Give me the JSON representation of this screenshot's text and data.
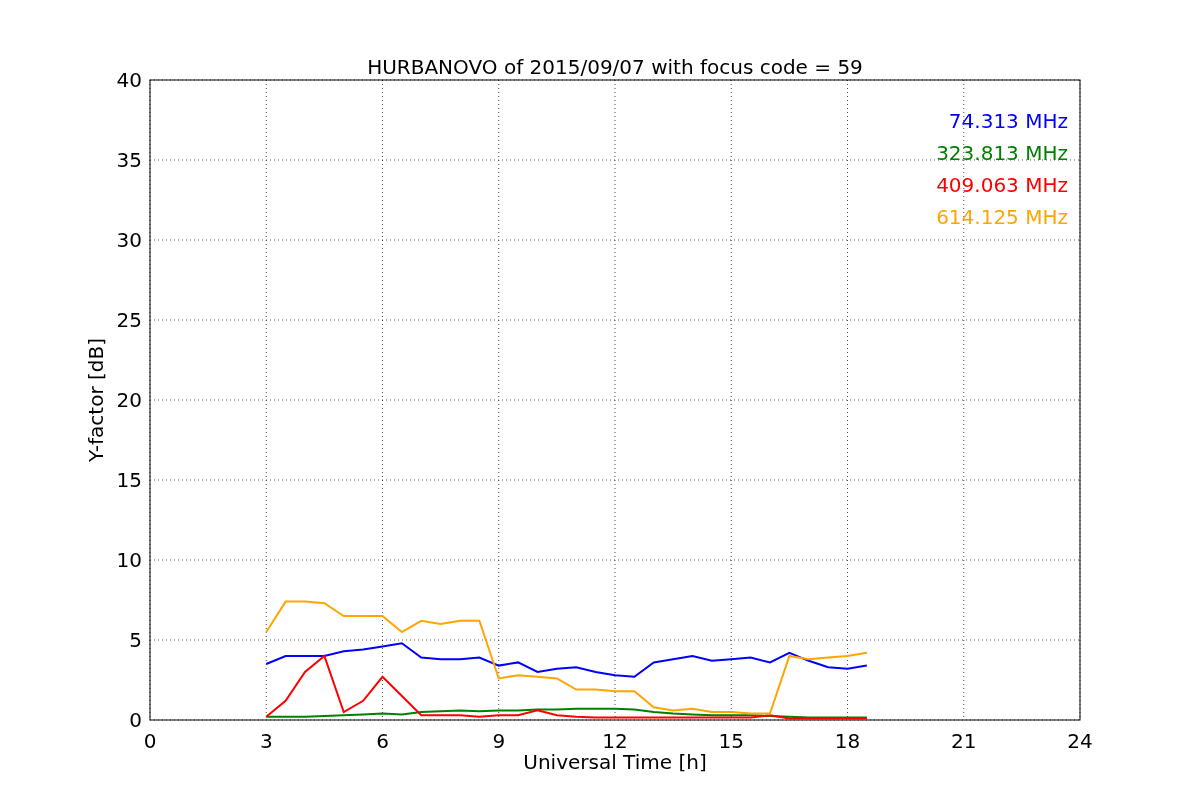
{
  "chart_data": {
    "type": "line",
    "title": "HURBANOVO of 2015/09/07 with focus code = 59",
    "xlabel": "Universal Time [h]",
    "ylabel": "Y-factor [dB]",
    "x": [
      3,
      3.5,
      4,
      4.5,
      5,
      5.5,
      6,
      6.5,
      7,
      7.5,
      8,
      8.5,
      9,
      9.5,
      10,
      10.5,
      11,
      11.5,
      12,
      12.5,
      13,
      13.5,
      14,
      14.5,
      15,
      15.5,
      16,
      16.5,
      17,
      17.5,
      18,
      18.5
    ],
    "series": [
      {
        "name": "74.313 MHz",
        "color": "#0000ff",
        "values": [
          3.5,
          4,
          4,
          4,
          4.3,
          4.4,
          4.6,
          4.8,
          3.9,
          3.8,
          3.8,
          3.9,
          3.4,
          3.6,
          3,
          3.2,
          3.3,
          3,
          2.8,
          2.7,
          3.6,
          3.8,
          4,
          3.7,
          3.8,
          3.9,
          3.6,
          4.2,
          3.7,
          3.3,
          3.2,
          3.4
        ]
      },
      {
        "name": "323.813 MHz",
        "color": "#008000",
        "values": [
          0.2,
          0.2,
          0.2,
          0.25,
          0.3,
          0.35,
          0.4,
          0.35,
          0.5,
          0.55,
          0.6,
          0.55,
          0.6,
          0.6,
          0.65,
          0.65,
          0.7,
          0.7,
          0.7,
          0.65,
          0.5,
          0.4,
          0.35,
          0.3,
          0.3,
          0.3,
          0.25,
          0.2,
          0.15,
          0.15,
          0.15,
          0.15
        ]
      },
      {
        "name": "409.063 MHz",
        "color": "#ff0000",
        "values": [
          0.2,
          1.2,
          3,
          4,
          0.5,
          1.2,
          2.7,
          1.5,
          0.3,
          0.3,
          0.3,
          0.2,
          0.3,
          0.3,
          0.6,
          0.3,
          0.2,
          0.15,
          0.15,
          0.15,
          0.15,
          0.15,
          0.15,
          0.15,
          0.15,
          0.15,
          0.3,
          0.1,
          0.1,
          0.1,
          0.1,
          0.1
        ]
      },
      {
        "name": "614.125 MHz",
        "color": "#ffa500",
        "values": [
          5.5,
          7.4,
          7.4,
          7.3,
          6.5,
          6.5,
          6.5,
          5.5,
          6.2,
          6,
          6.2,
          6.2,
          2.6,
          2.8,
          2.7,
          2.6,
          1.9,
          1.9,
          1.8,
          1.8,
          0.8,
          0.6,
          0.7,
          0.5,
          0.5,
          0.4,
          0.4,
          4,
          3.8,
          3.9,
          4,
          4.2
        ]
      }
    ],
    "grid": true,
    "xlim": [
      0,
      24
    ],
    "ylim": [
      0,
      40
    ],
    "xticks": [
      0,
      3,
      6,
      9,
      12,
      15,
      18,
      21,
      24
    ],
    "yticks": [
      0,
      5,
      10,
      15,
      20,
      25,
      30,
      35,
      40
    ]
  }
}
